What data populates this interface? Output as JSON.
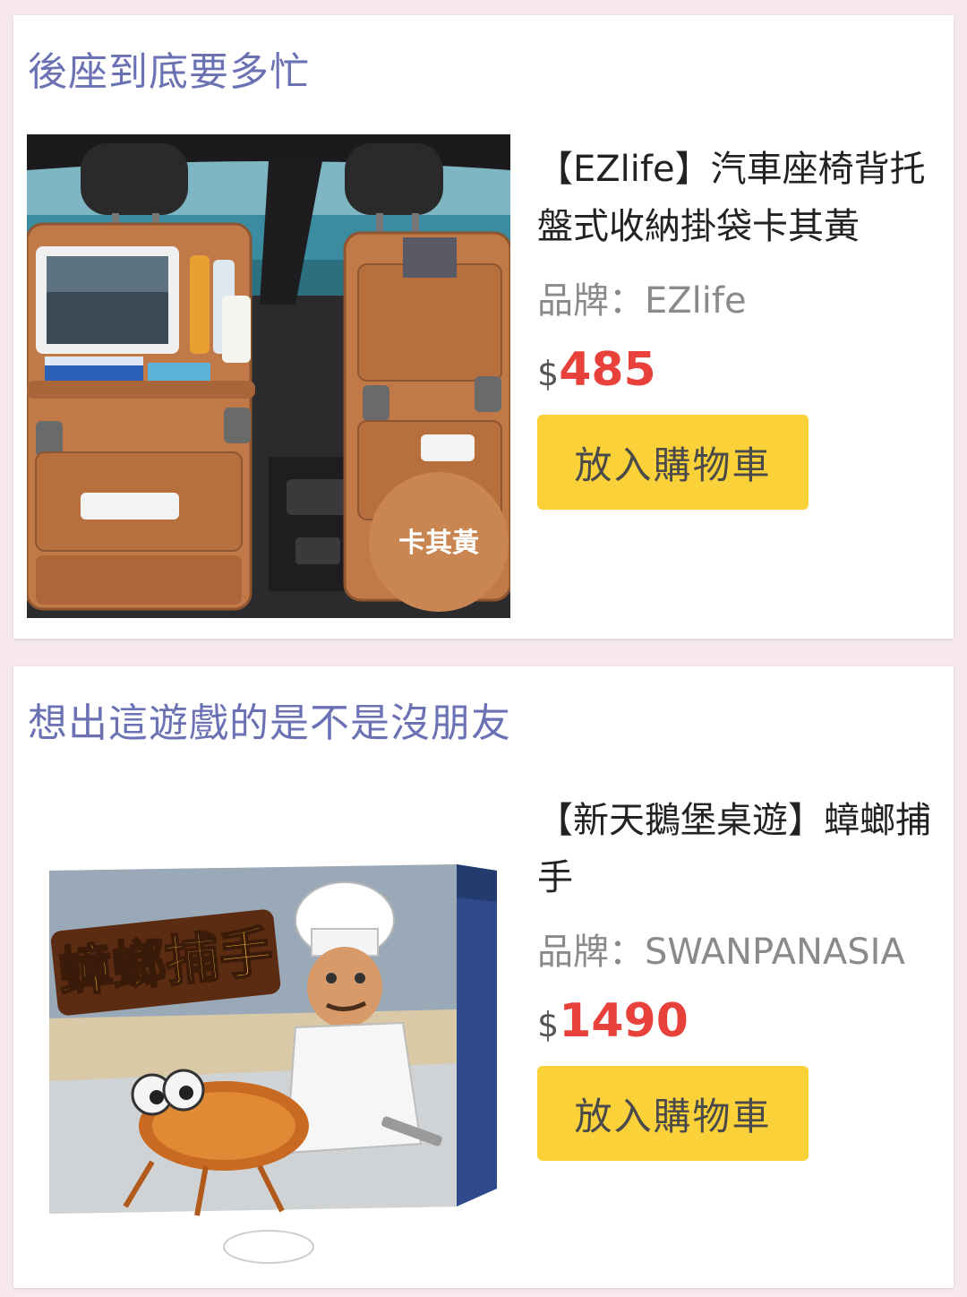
{
  "cards": [
    {
      "heading": "後座到底要多忙",
      "product": {
        "name": "【EZlife】汽車座椅背托盤式收納掛袋卡其黃",
        "brand_label": "品牌：",
        "brand": "EZlife",
        "currency": "$",
        "price": "485",
        "add_to_cart_label": "放入購物車",
        "image_badge": "卡其黃"
      }
    },
    {
      "heading": "想出這遊戲的是不是沒朋友",
      "product": {
        "name": "【新天鵝堡桌遊】蟑螂捕手",
        "brand_label": "品牌：",
        "brand": "SWANPANASIA",
        "currency": "$",
        "price": "1490",
        "add_to_cart_label": "放入購物車",
        "image_box_title": "蟑螂捕手"
      }
    }
  ],
  "colors": {
    "page_background": "#f7e9eb",
    "heading": "#6b72b4",
    "price": "#e8403a",
    "button": "#fbd13a"
  }
}
